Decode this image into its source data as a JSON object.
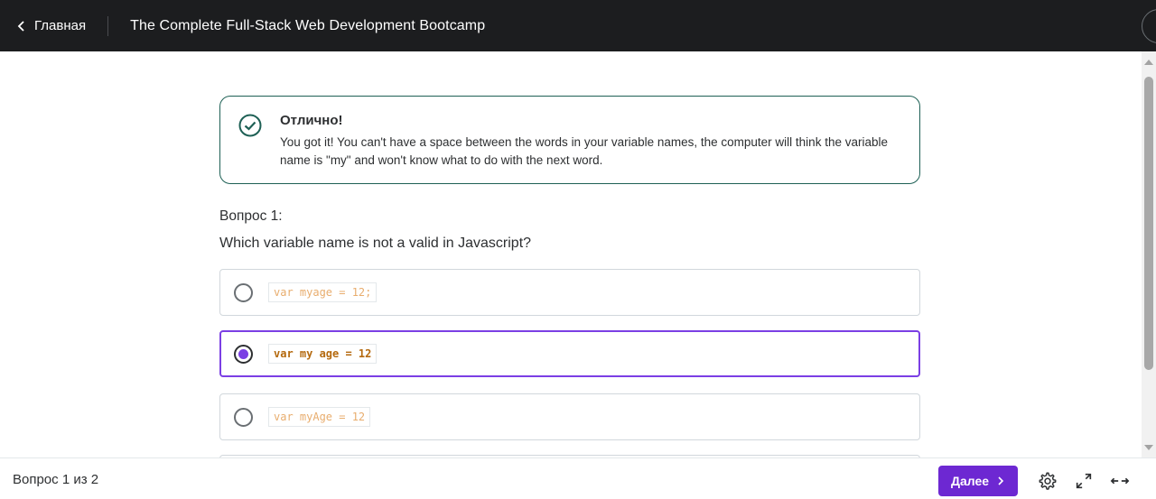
{
  "header": {
    "back_label": "Главная",
    "course_title": "The Complete Full-Stack Web Development Bootcamp"
  },
  "alert": {
    "icon": "check-circle-icon",
    "title": "Отлично!",
    "message": "You got it! You can't have a space between the words in your variable names, the computer will think the variable name is \"my\" and won't know what to do with the next word.",
    "color": "#1e6055"
  },
  "question": {
    "label": "Вопрос 1:",
    "text": "Which variable name is not a valid in Javascript?",
    "options": [
      {
        "code": "var myage = 12;",
        "selected": false
      },
      {
        "code": "var my age = 12",
        "selected": true
      },
      {
        "code": "var myAge = 12",
        "selected": false
      }
    ]
  },
  "footer": {
    "progress": "Вопрос 1 из 2",
    "next_label": "Далее",
    "icons": [
      "settings-icon",
      "fullscreen-icon",
      "expand-width-icon"
    ]
  },
  "colors": {
    "topbar": "#1c1d1f",
    "accent": "#6d28d2",
    "selected_border": "#7b3fe4"
  }
}
